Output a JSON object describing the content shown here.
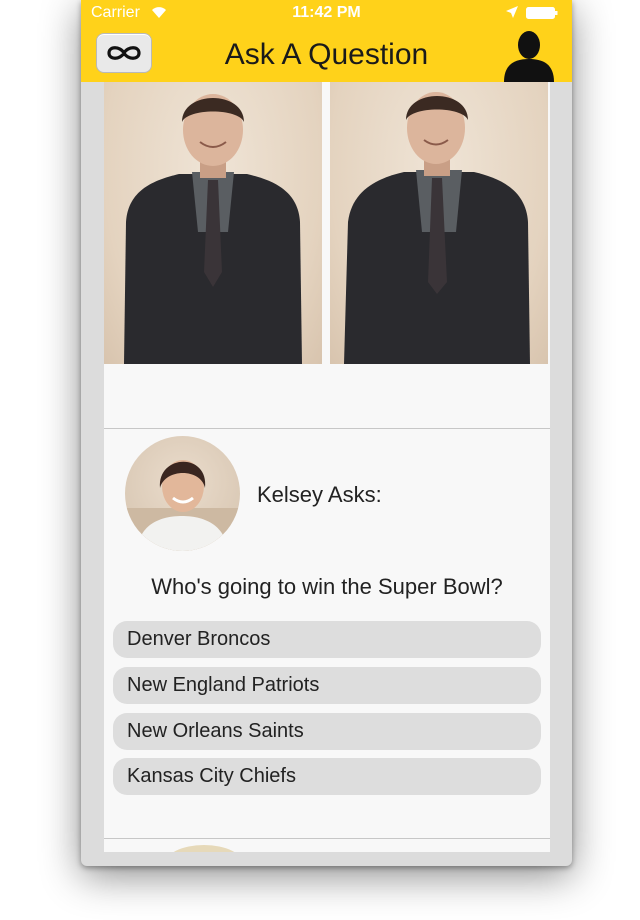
{
  "status_bar": {
    "carrier": "Carrier",
    "time": "11:42 PM",
    "wifi_icon": "wifi-icon",
    "location_icon": "location-arrow-icon",
    "battery_icon": "battery-icon"
  },
  "nav": {
    "title": "Ask A Question",
    "left_icon": "infinity-icon",
    "right_icon": "profile-silhouette-icon"
  },
  "post": {
    "asker_label": "Kelsey Asks:",
    "question": "Who's going to win the Super Bowl?",
    "options": [
      "Denver Broncos",
      "New England Patriots",
      "New Orleans Saints",
      "Kansas City Chiefs"
    ]
  },
  "colors": {
    "accent": "#ffd21a",
    "option_bg": "#dddddd",
    "card_bg": "#f8f8f8"
  }
}
